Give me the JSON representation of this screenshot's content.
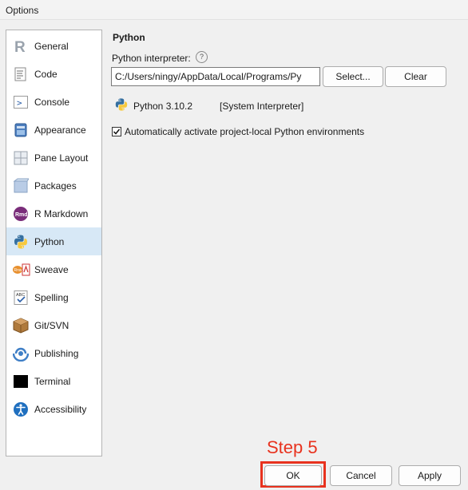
{
  "window": {
    "title": "Options"
  },
  "sidebar": {
    "items": [
      {
        "label": "General",
        "icon": "r-logo-icon"
      },
      {
        "label": "Code",
        "icon": "code-doc-icon"
      },
      {
        "label": "Console",
        "icon": "console-icon"
      },
      {
        "label": "Appearance",
        "icon": "appearance-icon"
      },
      {
        "label": "Pane Layout",
        "icon": "pane-layout-icon"
      },
      {
        "label": "Packages",
        "icon": "packages-icon"
      },
      {
        "label": "R Markdown",
        "icon": "rmd-icon"
      },
      {
        "label": "Python",
        "icon": "python-icon",
        "selected": true
      },
      {
        "label": "Sweave",
        "icon": "sweave-icon"
      },
      {
        "label": "Spelling",
        "icon": "spelling-icon"
      },
      {
        "label": "Git/SVN",
        "icon": "git-box-icon"
      },
      {
        "label": "Publishing",
        "icon": "publishing-icon"
      },
      {
        "label": "Terminal",
        "icon": "terminal-icon"
      },
      {
        "label": "Accessibility",
        "icon": "accessibility-icon"
      }
    ]
  },
  "python": {
    "heading": "Python",
    "interpreter_label": "Python interpreter:",
    "help": "?",
    "path_value": "C:/Users/ningy/AppData/Local/Programs/Py",
    "select_label": "Select...",
    "clear_label": "Clear",
    "version": "Python 3.10.2",
    "interp_type": "[System Interpreter]",
    "auto_activate_label": "Automatically activate project-local Python environments",
    "auto_activate_checked": true
  },
  "footer": {
    "ok_label": "OK",
    "cancel_label": "Cancel",
    "apply_label": "Apply"
  },
  "annotation": {
    "step_label": "Step 5",
    "color": "#e8321e"
  },
  "colors": {
    "selected_bg": "#d7e8f6",
    "python_blue": "#3670a0",
    "python_yellow": "#f7c93e"
  }
}
